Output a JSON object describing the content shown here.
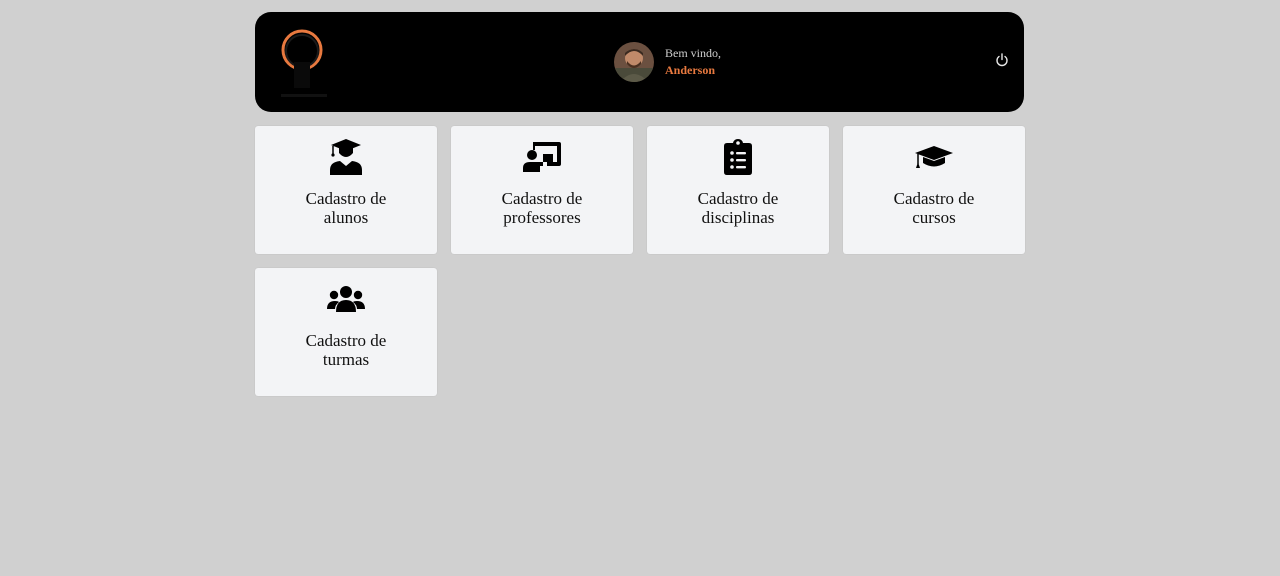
{
  "header": {
    "greeting": "Bem vindo,",
    "user_name": "Anderson",
    "icons": {
      "logo": "logo-icon",
      "avatar": "avatar",
      "logout": "power-icon"
    },
    "colors": {
      "background": "#000000",
      "accent": "#e8793f"
    }
  },
  "cards": [
    {
      "label": "Cadastro de alunos",
      "icon": "student-icon"
    },
    {
      "label": "Cadastro de professores",
      "icon": "teacher-icon"
    },
    {
      "label": "Cadastro de disciplinas",
      "icon": "clipboard-list-icon"
    },
    {
      "label": "Cadastro de cursos",
      "icon": "graduation-cap-icon"
    },
    {
      "label": "Cadastro de turmas",
      "icon": "group-icon"
    }
  ],
  "colors": {
    "page_background": "#d0d0d0",
    "card_background": "#f3f4f6"
  }
}
